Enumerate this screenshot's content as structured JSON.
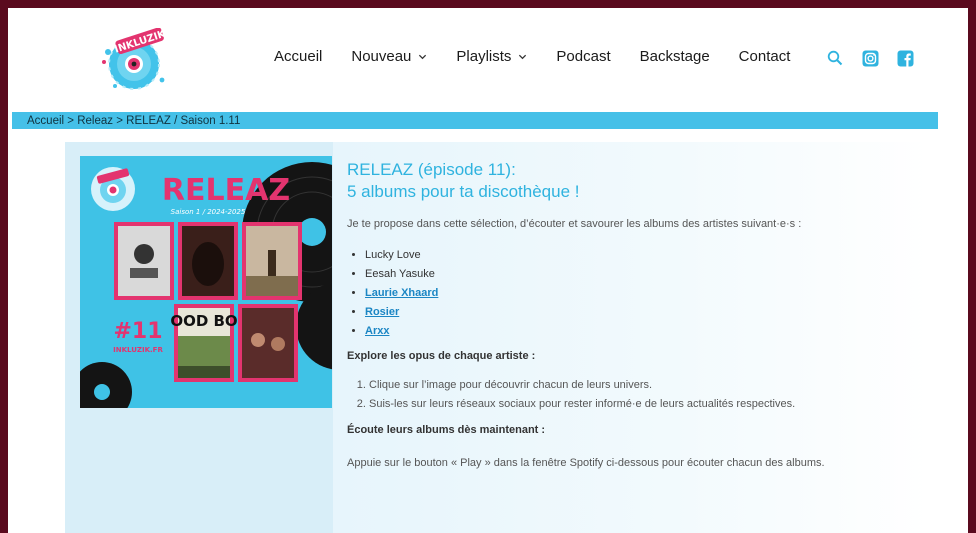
{
  "header": {
    "logo_text": "INKLUZIK",
    "nav": [
      {
        "label": "Accueil",
        "has_dropdown": false
      },
      {
        "label": "Nouveau",
        "has_dropdown": true
      },
      {
        "label": "Playlists",
        "has_dropdown": true
      },
      {
        "label": "Podcast",
        "has_dropdown": false
      },
      {
        "label": "Backstage",
        "has_dropdown": false
      },
      {
        "label": "Contact",
        "has_dropdown": false
      }
    ],
    "icons": [
      "search-icon",
      "instagram-icon",
      "facebook-icon"
    ],
    "accent_color": "#2fb3df"
  },
  "breadcrumb": {
    "items": [
      "Accueil",
      "Releaz",
      "RELEAZ / Saison 1.11"
    ],
    "separator": ">"
  },
  "cover": {
    "title": "RELEAZ",
    "subtitle": "Saison 1 / 2024-2025",
    "episode": "#11",
    "site": "INKLUZIK.FR",
    "album_text": "OOD BO"
  },
  "article": {
    "title_line1": "RELEAZ (épisode 11):",
    "title_line2": "5 albums pour ta discothèque !",
    "intro": "Je te propose dans cette sélection, d’écouter et savourer les albums des artistes suivant·e·s :",
    "artists": [
      {
        "name": "Lucky Love",
        "link": false
      },
      {
        "name": "Eesah Yasuke",
        "link": false
      },
      {
        "name": "Laurie Xhaard",
        "link": true
      },
      {
        "name": "Rosier",
        "link": true
      },
      {
        "name": "Arxx",
        "link": true
      }
    ],
    "explore_heading": "Explore les opus de chaque artiste :",
    "steps": [
      "Clique sur l’image pour découvrir chacun de leurs univers.",
      "Suis-les sur leurs réseaux sociaux pour rester informé·e de leurs actualités respectives."
    ],
    "listen_heading": "Écoute leurs albums dès maintenant :",
    "closing": "Appuie sur le bouton « Play » dans la fenêtre Spotify ci-dessous pour écouter chacun des albums."
  }
}
